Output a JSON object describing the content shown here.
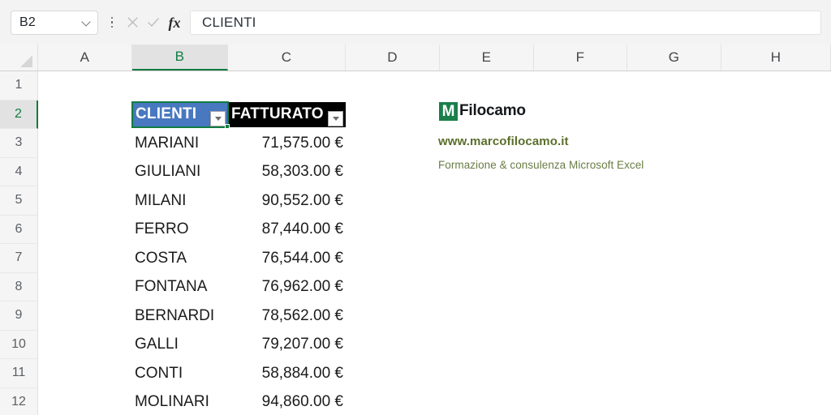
{
  "app": {
    "name": "Microsoft Excel",
    "accent_green": "#107c41",
    "header_blue": "#4878c0",
    "header_black": "#000000"
  },
  "formula_bar": {
    "name_box_value": "B2",
    "name_box_dropdown_icon": "chevron-down-icon",
    "more_icon": "kebab-menu-icon",
    "cancel_icon": "cancel-x-icon",
    "enter_icon": "enter-check-icon",
    "function_icon": "fx",
    "formula_value": "CLIENTI",
    "formula_placeholder": ""
  },
  "grid": {
    "column_headers": [
      "A",
      "B",
      "C",
      "D",
      "E",
      "F",
      "G",
      "H"
    ],
    "active_column": "B",
    "row_headers": [
      "1",
      "2",
      "3",
      "4",
      "5",
      "6",
      "7",
      "8",
      "9",
      "10",
      "11",
      "12"
    ],
    "active_row": "2",
    "select_all_icon": "select-all-corner-icon"
  },
  "table": {
    "headers": [
      {
        "col": "B",
        "label": "CLIENTI",
        "background": "#4878c0",
        "filter_icon": "filter-dropdown-icon"
      },
      {
        "col": "C",
        "label": "FATTURATO",
        "background": "#000000",
        "filter_icon": "filter-dropdown-icon"
      }
    ],
    "rows": [
      {
        "row": "3",
        "cliente": "MARIANI",
        "fatturato": "71,575.00 €"
      },
      {
        "row": "4",
        "cliente": "GIULIANI",
        "fatturato": "58,303.00 €"
      },
      {
        "row": "5",
        "cliente": "MILANI",
        "fatturato": "90,552.00 €"
      },
      {
        "row": "6",
        "cliente": "FERRO",
        "fatturato": "87,440.00 €"
      },
      {
        "row": "7",
        "cliente": "COSTA",
        "fatturato": "76,544.00 €"
      },
      {
        "row": "8",
        "cliente": "FONTANA",
        "fatturato": "76,962.00 €"
      },
      {
        "row": "9",
        "cliente": "BERNARDI",
        "fatturato": "78,562.00 €"
      },
      {
        "row": "10",
        "cliente": "GALLI",
        "fatturato": "79,207.00 €"
      },
      {
        "row": "11",
        "cliente": "CONTI",
        "fatturato": "58,884.00 €"
      },
      {
        "row": "12",
        "cliente": "MOLINARI",
        "fatturato": "94,860.00 €"
      }
    ]
  },
  "brand": {
    "mark_letter": "M",
    "mark_color": "#1a7f4b",
    "name": "Filocamo",
    "url": "www.marcofilocamo.it",
    "tagline": "Formazione & consulenza Microsoft Excel",
    "url_color": "#5a6f2b"
  }
}
